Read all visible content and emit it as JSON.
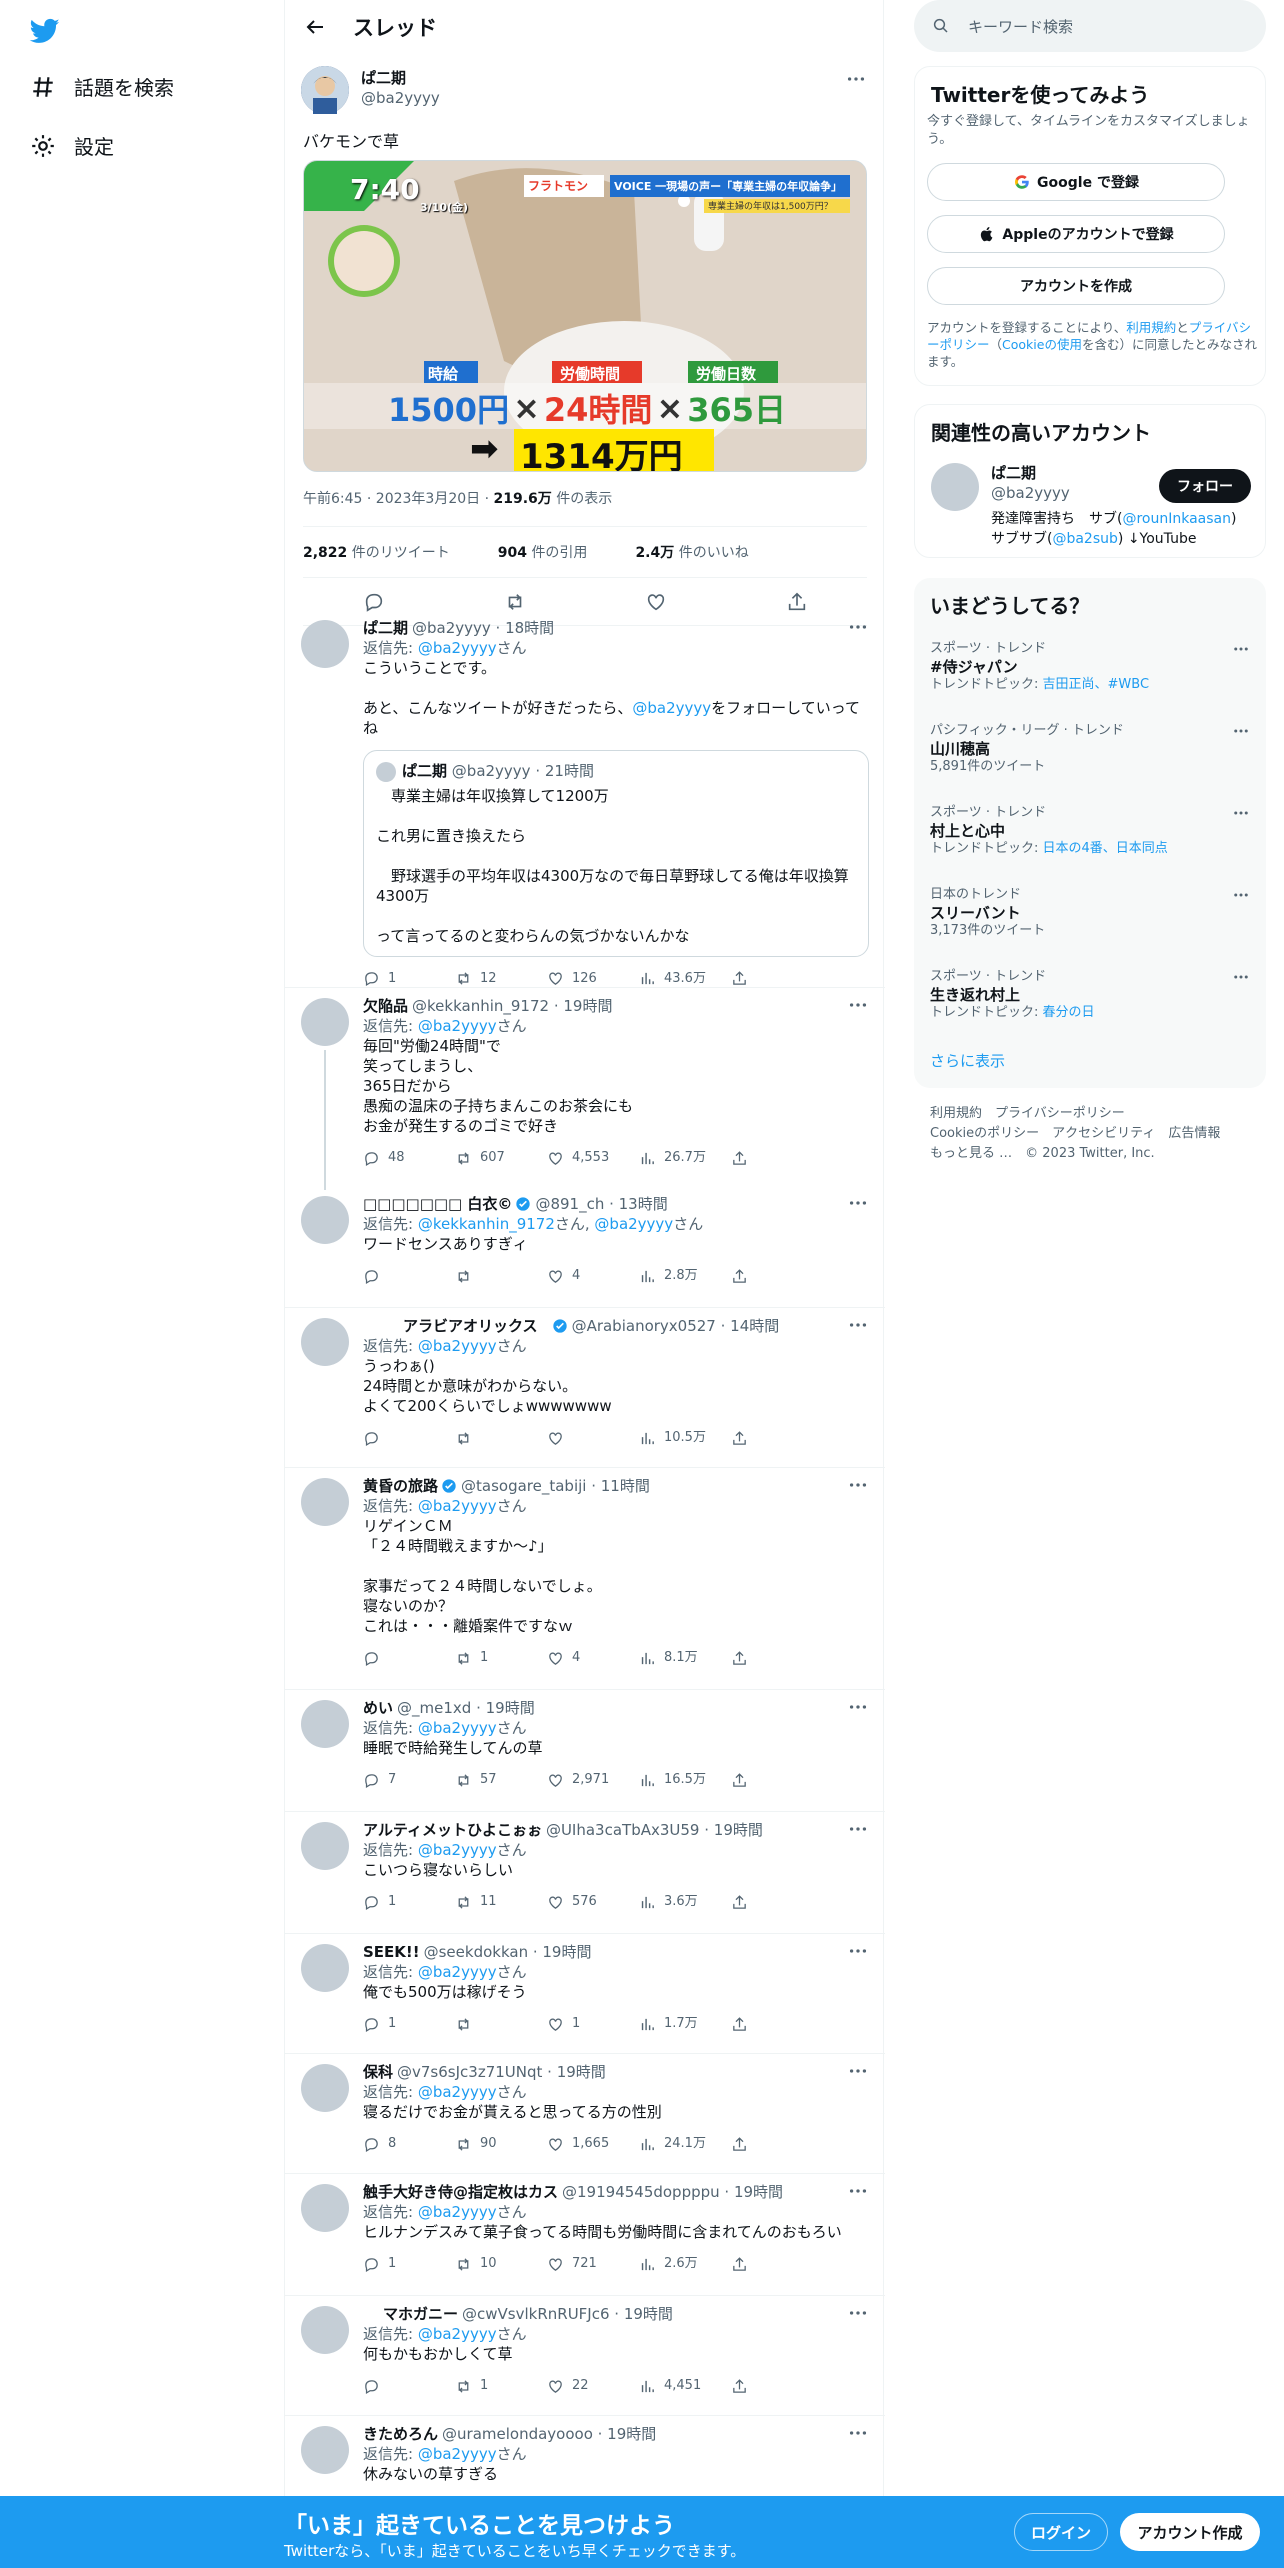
{
  "nav": {
    "explore": "話題を検索",
    "settings": "設定"
  },
  "header": {
    "title": "スレッド"
  },
  "main_tweet": {
    "name": "ぱ二期",
    "handle": "@ba2yyyy",
    "text": "バケモンで草",
    "image": {
      "time": "7:40",
      "date": "3/10(金)",
      "logo": "フラトモン",
      "banner": "VOICE 一現場の声ー「専業主婦の年収論争」",
      "subbanner": "専業主婦の年収は1,500万円？",
      "label1": "時給",
      "val1": "1500円",
      "label2": "労働時間",
      "val2": "24時間",
      "label3": "労働日数",
      "val3": "365日",
      "times": "×",
      "arrow": "➡",
      "result": "1314万円"
    },
    "meta_time": "午前6:45 · 2023年3月20日 · ",
    "meta_views": "219.6万",
    "meta_views_suffix": " 件の表示",
    "retweets": "2,822",
    "retweets_label": "件のリツイート",
    "quotes": "904",
    "quotes_label": "件の引用",
    "likes": "2.4万",
    "likes_label": "件のいいね"
  },
  "replies": [
    {
      "name": "ぱ二期",
      "handle": "@ba2yyyy · 18時間",
      "to": "返信先: ",
      "to_link": "@ba2yyyy",
      "to_suffix": "さん",
      "text1": "こういうことです。",
      "text2a": "あと、こんなツイートが好きだったら、",
      "text2link": "@ba2yyyy",
      "text2b": "をフォローしていってね",
      "quote": {
        "name": "ぱ二期",
        "handle": "@ba2yyyy · 21時間",
        "text": "　専業主婦は年収換算して1200万\n\nこれ男に置き換えたら\n\n　野球選手の平均年収は4300万なので毎日草野球してる俺は年収換算4300万\n\nって言ってるのと変わらんの気づかないんかな"
      },
      "c_reply": "1",
      "c_rt": "12",
      "c_like": "126",
      "c_view": "43.6万"
    },
    {
      "name": "欠陥品",
      "handle": "@kekkanhin_9172 · 19時間",
      "to": "返信先: ",
      "to_link": "@ba2yyyy",
      "to_suffix": "さん",
      "text": "毎回\"労働24時間\"で\n笑ってしまうし、\n365日だから\n愚痴の温床の子持ちまんこのお茶会にも\nお金が発生するのゴミで好き",
      "c_reply": "48",
      "c_rt": "607",
      "c_like": "4,553",
      "c_view": "26.7万"
    },
    {
      "name": "□□□□□□□ 白衣©",
      "handle": "@891_ch · 13時間",
      "to": "返信先: ",
      "to_link": "@kekkanhin_9172",
      "to_mid": "さん, ",
      "to_link2": "@ba2yyyy",
      "to_suffix": "さん",
      "text": "ワードセンスありすぎィ",
      "c_reply": "",
      "c_rt": "",
      "c_like": "4",
      "c_view": "2.8万"
    },
    {
      "name": "アラビアオリックス",
      "handle": "@Arabianoryx0527 · 14時間",
      "to": "返信先: ",
      "to_link": "@ba2yyyy",
      "to_suffix": "さん",
      "text": "うっわぁ()\n24時間とか意味がわからない。\nよくて200くらいでしょwwwwwww",
      "c_reply": "",
      "c_rt": "",
      "c_like": "",
      "c_view": "10.5万"
    },
    {
      "name": "黄昏の旅路",
      "handle": "@tasogare_tabiji · 11時間",
      "to": "返信先: ",
      "to_link": "@ba2yyyy",
      "to_suffix": "さん",
      "text": "リゲインＣＭ\n「２４時間戦えますか～♪」\n\n家事だって２４時間しないでしょ。\n寝ないのか？\nこれは・・・離婚案件ですなｗ",
      "c_reply": "",
      "c_rt": "1",
      "c_like": "4",
      "c_view": "8.1万"
    },
    {
      "name": "めい",
      "handle": "@_me1xd · 19時間",
      "to": "返信先: ",
      "to_link": "@ba2yyyy",
      "to_suffix": "さん",
      "text": "睡眠で時給発生してんの草",
      "c_reply": "7",
      "c_rt": "57",
      "c_like": "2,971",
      "c_view": "16.5万"
    },
    {
      "name": "アルティメットひよこぉぉ",
      "handle": "@UIha3caTbAx3U59 · 19時間",
      "to": "返信先: ",
      "to_link": "@ba2yyyy",
      "to_suffix": "さん",
      "text": "こいつら寝ないらしい",
      "c_reply": "1",
      "c_rt": "11",
      "c_like": "576",
      "c_view": "3.6万"
    },
    {
      "name": "SEEK!!",
      "handle": "@seekdokkan · 19時間",
      "to": "返信先: ",
      "to_link": "@ba2yyyy",
      "to_suffix": "さん",
      "text": "俺でも500万は稼げそう",
      "c_reply": "1",
      "c_rt": "",
      "c_like": "1",
      "c_view": "1.7万"
    },
    {
      "name": "保科",
      "handle": "@v7s6sJc3z71UNqt · 19時間",
      "to": "返信先: ",
      "to_link": "@ba2yyyy",
      "to_suffix": "さん",
      "text": "寝るだけでお金が貰えると思ってる方の性別",
      "c_reply": "8",
      "c_rt": "90",
      "c_like": "1,665",
      "c_view": "24.1万"
    },
    {
      "name": "触手大好き侍@指定枚はカス",
      "handle": "@19194545doppppu · 19時間",
      "to": "返信先: ",
      "to_link": "@ba2yyyy",
      "to_suffix": "さん",
      "text": "ヒルナンデスみて菓子食ってる時間も労働時間に含まれてんのおもろい",
      "c_reply": "1",
      "c_rt": "10",
      "c_like": "721",
      "c_view": "2.6万"
    },
    {
      "name": "マホガニー",
      "handle": "@cwVsvlkRnRUFJc6 · 19時間",
      "to": "返信先: ",
      "to_link": "@ba2yyyy",
      "to_suffix": "さん",
      "text": "何もかもおかしくて草",
      "c_reply": "",
      "c_rt": "1",
      "c_like": "22",
      "c_view": "4,451"
    },
    {
      "name": "きためろん",
      "handle": "@uramelondayoooo · 19時間",
      "to": "返信先: ",
      "to_link": "@ba2yyyy",
      "to_suffix": "さん",
      "text": "休みないの草すぎる",
      "c_reply": "",
      "c_rt": "",
      "c_like": "",
      "c_view": ""
    }
  ],
  "sidebar": {
    "search_placeholder": "キーワード検索",
    "signup": {
      "title": "Twitterを使ってみよう",
      "desc": "今すぐ登録して、タイムラインをカスタマイズしましょう。",
      "google": "Google で登録",
      "apple": "Appleのアカウントで登録",
      "create": "アカウントを作成",
      "legal1": "アカウントを登録することにより、",
      "legal_terms": "利用規約",
      "legal2": "と",
      "legal_privacy": "プライバシーポリシー",
      "legal3": "（",
      "legal_cookie": "Cookieの使用",
      "legal4": "を含む）に同意したとみなされます。"
    },
    "related": {
      "title": "関連性の高いアカウント",
      "name": "ぱ二期",
      "handle": "@ba2yyyy",
      "follow": "フォロー",
      "bio1": "発達障害持ち　サブ(",
      "bio_link1": "@rounInkaasan",
      "bio2": ")",
      "bio3": "サブサブ(",
      "bio_link2": "@ba2sub",
      "bio4": ") ↓YouTube"
    },
    "trends": {
      "title": "いまどうしてる？",
      "items": [
        {
          "cat": "スポーツ · トレンド",
          "title": "#侍ジャパン",
          "sub_prefix": "トレンドトピック: ",
          "sub_link": "吉田正尚、#WBC"
        },
        {
          "cat": "パシフィック・リーグ · トレンド",
          "title": "山川穂高",
          "sub_plain": "5,891件のツイート"
        },
        {
          "cat": "スポーツ · トレンド",
          "title": "村上と心中",
          "sub_prefix": "トレンドトピック: ",
          "sub_link": "日本の4番、日本同点"
        },
        {
          "cat": "日本のトレンド",
          "title": "スリーバント",
          "sub_plain": "3,173件のツイート"
        },
        {
          "cat": "スポーツ · トレンド",
          "title": "生き返れ村上",
          "sub_prefix": "トレンドトピック: ",
          "sub_link": "春分の日"
        }
      ],
      "show_more": "さらに表示"
    },
    "footer": {
      "terms": "利用規約",
      "privacy": "プライバシーポリシー",
      "cookie": "Cookieのポリシー",
      "a11y": "アクセシビリティ",
      "ads": "広告情報",
      "more": "もっと見る …",
      "copy": "© 2023 Twitter, Inc."
    }
  },
  "bottom_bar": {
    "title": "「いま」起きていることを見つけよう",
    "subtitle": "Twitterなら、「いま」起きていることをいち早くチェックできます。",
    "login": "ログイン",
    "signup": "アカウント作成"
  },
  "colors": {
    "accent": "#1d9bf0",
    "text": "#0f1419",
    "muted": "#536471"
  }
}
